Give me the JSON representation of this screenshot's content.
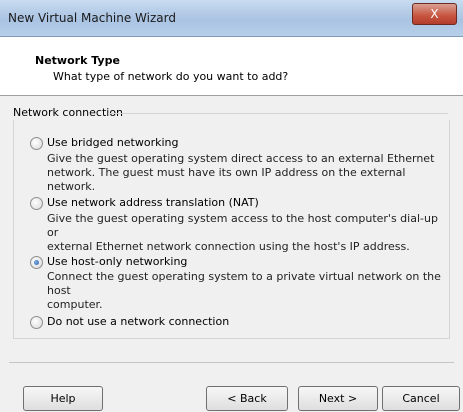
{
  "window": {
    "title": "New Virtual Machine Wizard",
    "close_glyph": "X"
  },
  "header": {
    "title": "Network Type",
    "subtitle": "What type of network do you want to add?"
  },
  "group": {
    "label": "Network connection"
  },
  "options": [
    {
      "label": "Use bridged networking",
      "desc_line1": "Give the guest operating system direct access to an external Ethernet",
      "desc_line2": "network. The guest must have its own IP address on the external network.",
      "selected": false
    },
    {
      "label": "Use network address translation (NAT)",
      "desc_line1": "Give the guest operating system access to the host computer's dial-up or",
      "desc_line2": "external Ethernet network connection using the host's IP address.",
      "selected": false
    },
    {
      "label": "Use host-only networking",
      "desc_line1": "Connect the guest operating system to a private virtual network on the host",
      "desc_line2": "computer.",
      "selected": true
    },
    {
      "label": "Do not use a network connection",
      "selected": false
    }
  ],
  "buttons": {
    "help": "Help",
    "back": "< Back",
    "next": "Next >",
    "cancel": "Cancel"
  }
}
